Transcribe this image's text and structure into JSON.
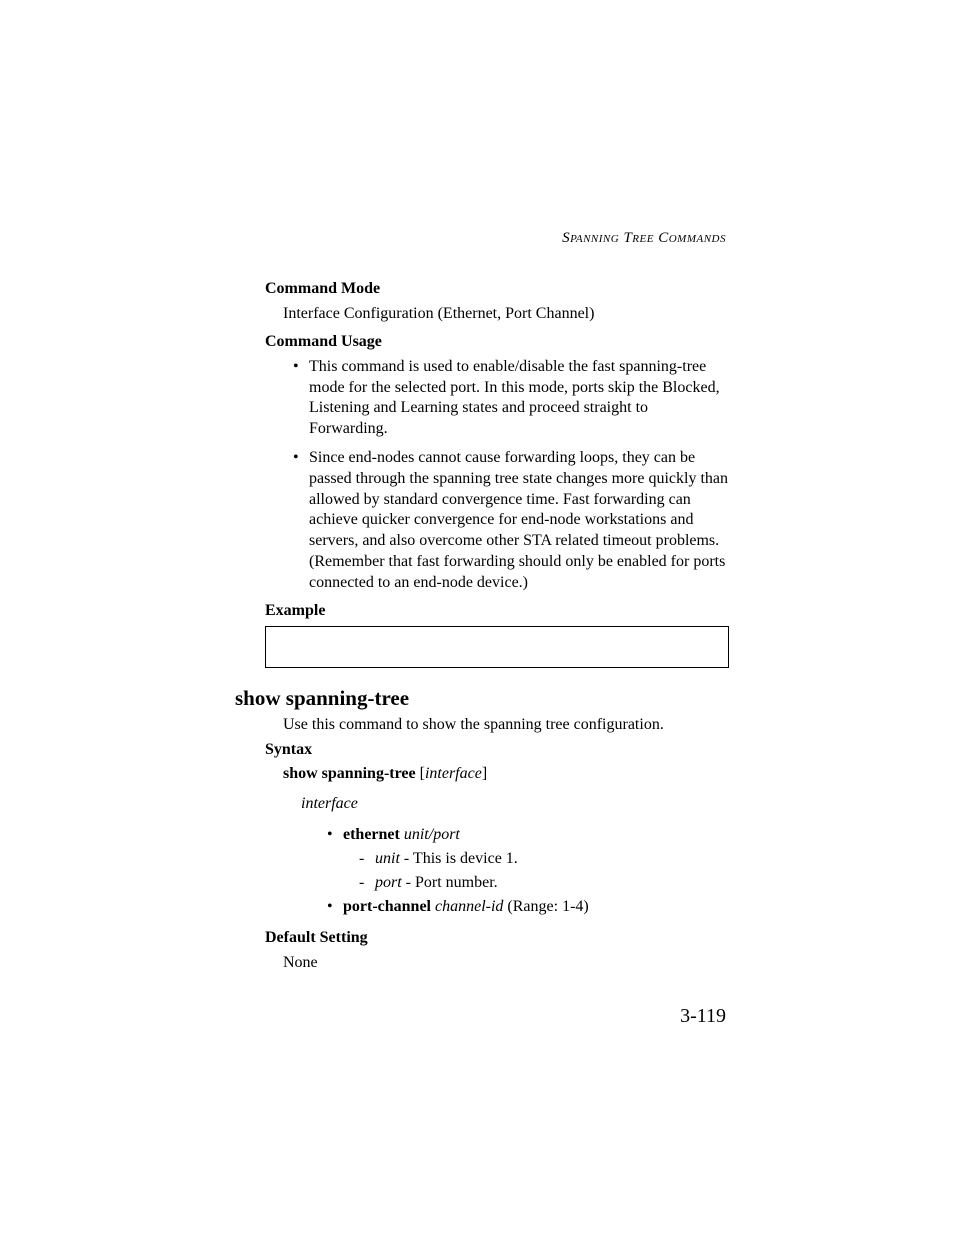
{
  "header": "Spanning Tree Commands",
  "sections": {
    "commandMode": {
      "heading": "Command Mode",
      "text": "Interface Configuration (Ethernet, Port Channel)"
    },
    "commandUsage": {
      "heading": "Command Usage",
      "bullets": [
        "This command is used to enable/disable the fast spanning-tree mode for the selected port. In this mode, ports skip the Blocked, Listening and Learning states and proceed straight to Forwarding.",
        "Since end-nodes cannot cause forwarding loops, they can be passed through the spanning tree state changes more quickly than allowed by standard convergence time. Fast forwarding can achieve quicker convergence for end-node workstations and servers, and also overcome other STA related timeout problems. (Remember that fast forwarding should only be enabled for ports connected to an end-node device.)"
      ]
    },
    "example": {
      "heading": "Example"
    },
    "showSpanningTree": {
      "title": "show spanning-tree",
      "description": "Use this command to show the spanning tree configuration.",
      "syntax": {
        "heading": "Syntax",
        "cmdBold": "show spanning-tree",
        "cmdOpen": " [",
        "cmdItalic": "interface",
        "cmdClose": "]",
        "interfaceLabel": "interface",
        "ethernet": {
          "bold": "ethernet",
          "italic": "unit/port",
          "unitItalic": "unit",
          "unitText": " - This is device 1.",
          "portItalic": "port",
          "portText": " - Port number."
        },
        "portChannel": {
          "bold": "port-channel",
          "italic": "channel-id",
          "text": " (Range: 1-4)"
        }
      },
      "defaultSetting": {
        "heading": "Default Setting",
        "text": "None"
      }
    }
  },
  "pageNumber": "3-119"
}
